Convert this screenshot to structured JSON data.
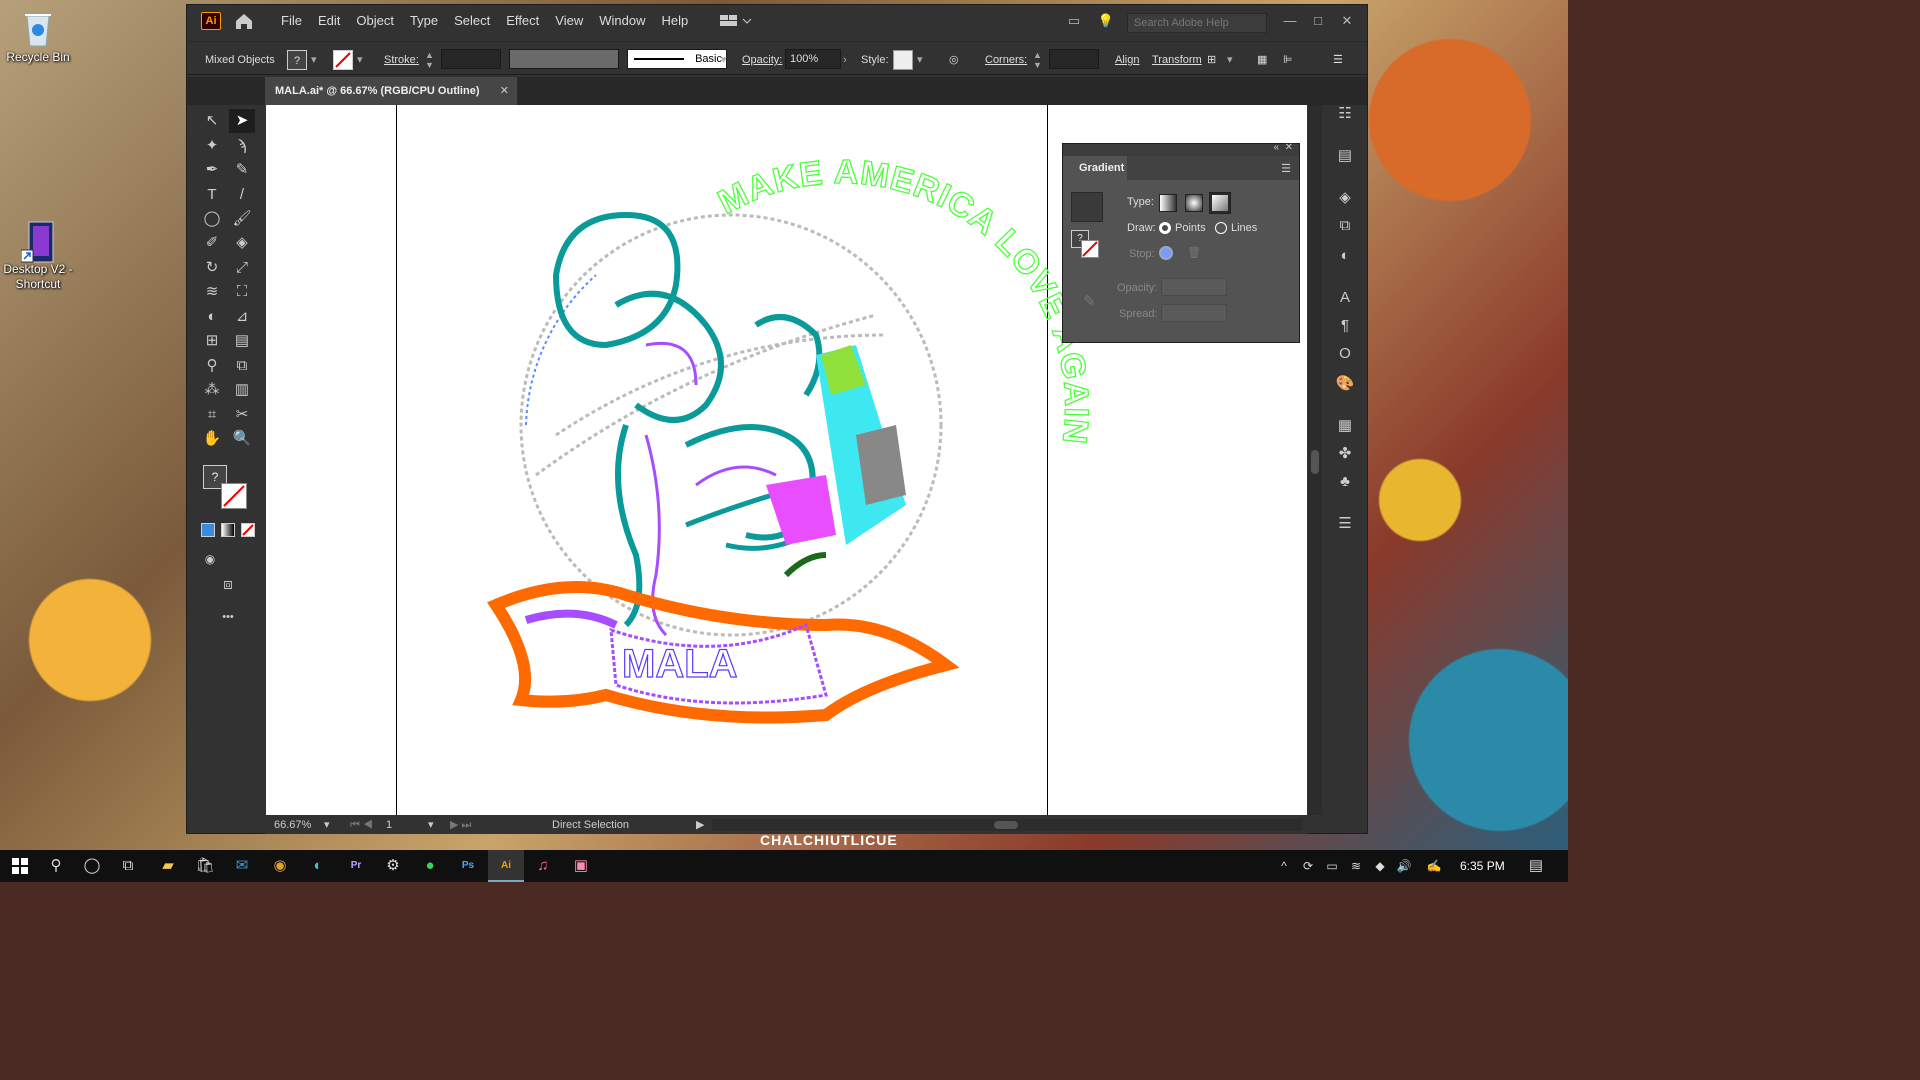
{
  "desktop": {
    "icons": [
      {
        "label": "Recycle Bin"
      },
      {
        "label": "Desktop V2 - Shortcut"
      }
    ],
    "wallpaper_text": "CHALCHIUTLICUE"
  },
  "app": {
    "logo": "Ai",
    "menu": [
      "File",
      "Edit",
      "Object",
      "Type",
      "Select",
      "Effect",
      "View",
      "Window",
      "Help"
    ],
    "search_placeholder": "Search Adobe Help",
    "window_controls": {
      "minimize": "—",
      "maximize": "□",
      "close": "✕"
    }
  },
  "control_bar": {
    "selection": "Mixed Objects",
    "fill_unknown": "?",
    "stroke_label": "Stroke:",
    "stroke_style": "Basic",
    "opacity_label": "Opacity:",
    "opacity_value": "100%",
    "style_label": "Style:",
    "corners_label": "Corners:",
    "align_label": "Align",
    "transform_label": "Transform"
  },
  "document": {
    "tab_title": "MALA.ai* @ 66.67% (RGB/CPU Outline)",
    "tab_close": "✕"
  },
  "artwork": {
    "arc_text": "MAKE AMERICA LOVE AGAIN",
    "banner_text": "MALA"
  },
  "gradient_panel": {
    "title": "Gradient",
    "type_label": "Type:",
    "draw_label": "Draw:",
    "points_label": "Points",
    "lines_label": "Lines",
    "stop_label": "Stop:",
    "opacity_label": "Opacity:",
    "spread_label": "Spread:",
    "swatch_unknown": "?"
  },
  "status_bar": {
    "zoom": "66.67%",
    "artboard": "1",
    "tool": "Direct Selection"
  },
  "toolbar": {
    "fill_unknown": "?",
    "more": "•••"
  },
  "taskbar": {
    "time": "6:35 PM",
    "apps": [
      "File Explorer",
      "Store",
      "Mail",
      "Chrome",
      "Edge",
      "Premiere Pro",
      "Steam",
      "Spotify",
      "Photoshop",
      "Illustrator",
      "iTunes",
      "Photos"
    ]
  },
  "colors": {
    "accent_orange": "#ff9a00",
    "teal": "#0a9a9a",
    "purple": "#a64dff",
    "banner_orange": "#ff6a00",
    "green_text": "#4cff3a"
  }
}
